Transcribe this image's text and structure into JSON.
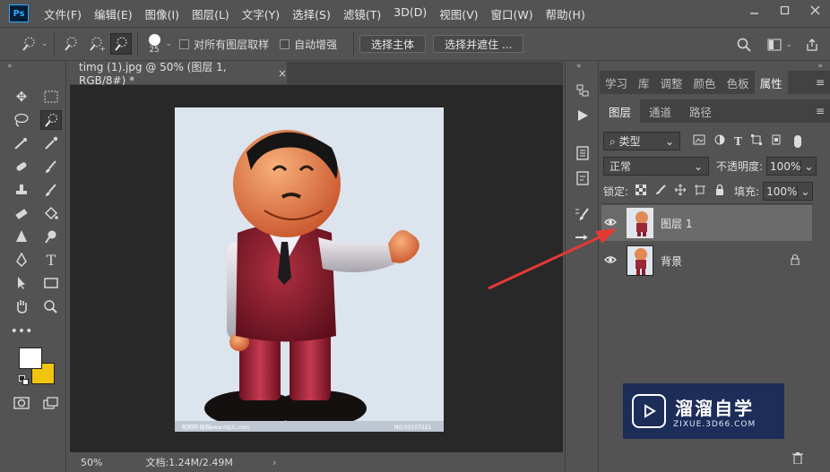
{
  "app": {
    "logo_text": "Ps"
  },
  "menu": [
    "文件(F)",
    "编辑(E)",
    "图像(I)",
    "图层(L)",
    "文字(Y)",
    "选择(S)",
    "滤镜(T)",
    "3D(D)",
    "视图(V)",
    "窗口(W)",
    "帮助(H)"
  ],
  "options": {
    "brush_size": "25",
    "sample_all_layers": "对所有图层取样",
    "auto_enhance": "自动增强",
    "select_subject": "选择主体",
    "select_and_mask": "选择并遮住 ..."
  },
  "document": {
    "tab_title": "timg (1).jpg @ 50% (图层 1, RGB/8#) *",
    "zoom": "50%",
    "doc_info": "文档:1.24M/2.49M",
    "watermark_left": "昵图网·版权",
    "watermark_mid": "www.nipic.com",
    "watermark_right": "NO.00107221"
  },
  "panels": {
    "top_tabs": [
      "学习",
      "库",
      "调整",
      "颜色",
      "色板",
      "属性"
    ],
    "layer_tabs": [
      "图层",
      "通道",
      "路径"
    ],
    "filter_kind": "类型",
    "blend_mode": "正常",
    "opacity_label": "不透明度:",
    "opacity_value": "100%",
    "lock_label": "锁定:",
    "fill_label": "填充:",
    "fill_value": "100%",
    "layers": [
      {
        "name": "图层 1",
        "selected": true
      },
      {
        "name": "背景",
        "locked": true
      }
    ]
  },
  "overlay": {
    "brand_name": "溜溜自学",
    "brand_url": "ZIXUE.3D66.COM"
  },
  "colors": {
    "foreground": "#ffffff",
    "background": "#f1c40f",
    "accent_arrow": "#e53935"
  }
}
